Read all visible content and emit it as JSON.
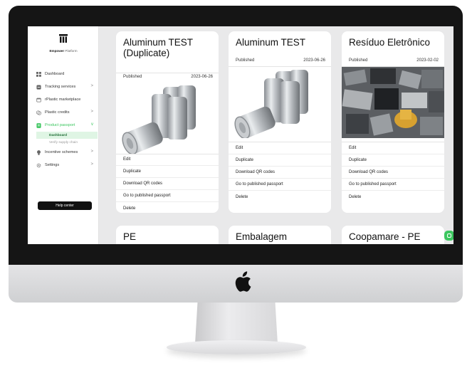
{
  "sidebar": {
    "brand": {
      "name": "Empower",
      "suffix": "Platform"
    },
    "items": [
      {
        "label": "Dashboard",
        "icon": "grid-icon"
      },
      {
        "label": "Tracking services",
        "icon": "tracking-icon",
        "chevron": ">"
      },
      {
        "label": "rPlastic marketplace",
        "icon": "marketplace-icon"
      },
      {
        "label": "Plastic credits",
        "icon": "credits-icon",
        "chevron": ">"
      },
      {
        "label": "Product passport",
        "icon": "passport-icon",
        "chevron": "v"
      },
      {
        "label": "Incentive schemes",
        "icon": "incentive-icon",
        "chevron": ">"
      },
      {
        "label": "Settings",
        "icon": "gear-icon",
        "chevron": ">"
      }
    ],
    "sub_items": [
      "Dashboard",
      "Verify supply chain"
    ],
    "help_label": "Help center"
  },
  "cards": [
    {
      "title": "Aluminum TEST (Duplicate)",
      "status": "Published",
      "date": "2023-06-26",
      "image": "aluminum-cans"
    },
    {
      "title": "Aluminum TEST",
      "status": "Published",
      "date": "2023-06-26",
      "image": "aluminum-cans"
    },
    {
      "title": "Resíduo Eletrônico",
      "status": "Published",
      "date": "2023-02-02",
      "image": "electronic-waste"
    },
    {
      "title": "PE"
    },
    {
      "title": "Embalagem"
    },
    {
      "title": "Coopamare - PE"
    }
  ],
  "actions": [
    "Edit",
    "Duplicate",
    "Download QR codes",
    "Go to published passport",
    "Delete"
  ],
  "colors": {
    "accent": "#3cc65f",
    "active_bg": "#dff5e4",
    "bezel": "#151515"
  },
  "chat_icon": "chat-bubble-icon",
  "device_logo": "apple-logo-icon"
}
